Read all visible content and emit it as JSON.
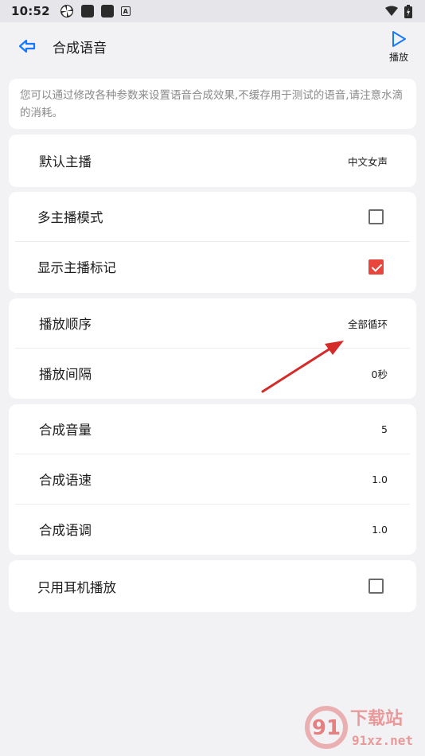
{
  "status_bar": {
    "time": "10:52",
    "icons_left": [
      "pinwheel-icon",
      "square-icon",
      "square-icon",
      "text-a-icon"
    ],
    "icons_right": [
      "wifi-icon",
      "battery-icon"
    ]
  },
  "header": {
    "title": "合成语音",
    "play_label": "播放",
    "accent_color": "#1677ff"
  },
  "notice": {
    "text": "您可以通过修改各种参数来设置语音合成效果,不缓存用于测试的语音,请注意水滴的消耗。"
  },
  "settings": {
    "anchor": {
      "label": "默认主播",
      "value": "中文女声"
    },
    "multi_anchor": {
      "label": "多主播模式",
      "checked": false
    },
    "show_mark": {
      "label": "显示主播标记",
      "checked": true
    },
    "play_order": {
      "label": "播放顺序",
      "value": "全部循环"
    },
    "play_interval": {
      "label": "播放间隔",
      "value": "0秒"
    },
    "volume": {
      "label": "合成音量",
      "value": "5"
    },
    "speed": {
      "label": "合成语速",
      "value": "1.0"
    },
    "pitch": {
      "label": "合成语调",
      "value": "1.0"
    },
    "earphone_only": {
      "label": "只用耳机播放",
      "checked": false
    }
  },
  "colors": {
    "checkbox_checked": "#e8453c",
    "annotation_arrow": "#d42a2a"
  },
  "watermark": {
    "text_cn": "下载站",
    "text_url": "91xz.net"
  }
}
